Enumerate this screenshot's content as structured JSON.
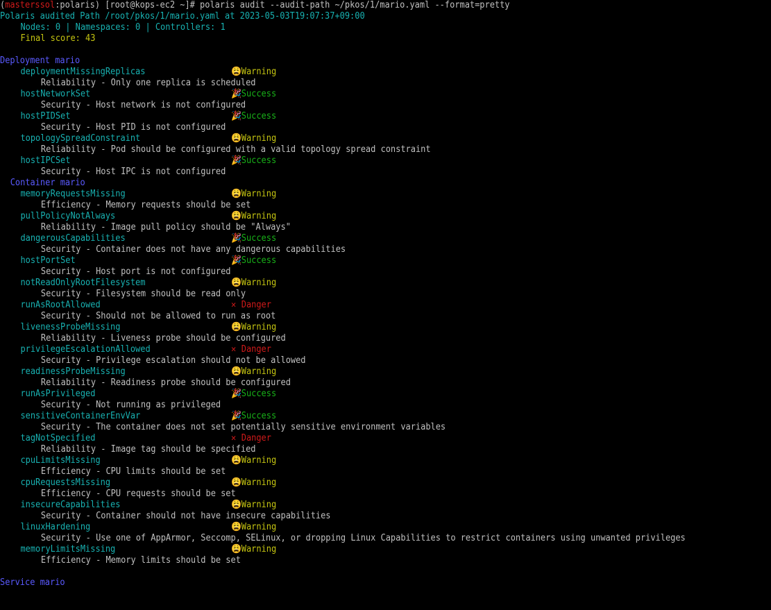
{
  "prompt": {
    "open_paren": "(",
    "cluster": "masterssol",
    "sep": ":",
    "namespace": "polaris",
    "close_paren": ")",
    "user_host": " [root@kops-ec2 ~]# ",
    "command": "polaris audit --audit-path ~/pkos/1/mario.yaml --format=pretty"
  },
  "summary": {
    "audited": "Polaris audited Path /root/pkos/1/mario.yaml at 2023-05-03T19:07:37+09:00",
    "counts": "Nodes: 0 | Namespaces: 0 | Controllers: 1",
    "score": "Final score: 43"
  },
  "status_icons": {
    "Warning": "😩",
    "Success": "🎉",
    "Danger": "✕"
  },
  "deployment": {
    "heading": "Deployment mario",
    "checks": [
      {
        "name": "deploymentMissingReplicas",
        "status": "Warning",
        "detail": "Reliability - Only one replica is scheduled"
      },
      {
        "name": "hostNetworkSet",
        "status": "Success",
        "detail": "Security - Host network is not configured"
      },
      {
        "name": "hostPIDSet",
        "status": "Success",
        "detail": "Security - Host PID is not configured"
      },
      {
        "name": "topologySpreadConstraint",
        "status": "Warning",
        "detail": "Reliability - Pod should be configured with a valid topology spread constraint"
      },
      {
        "name": "hostIPCSet",
        "status": "Success",
        "detail": "Security - Host IPC is not configured"
      }
    ]
  },
  "container": {
    "heading": "Container mario",
    "checks": [
      {
        "name": "memoryRequestsMissing",
        "status": "Warning",
        "detail": "Efficiency - Memory requests should be set"
      },
      {
        "name": "pullPolicyNotAlways",
        "status": "Warning",
        "detail": "Reliability - Image pull policy should be \"Always\""
      },
      {
        "name": "dangerousCapabilities",
        "status": "Success",
        "detail": "Security - Container does not have any dangerous capabilities"
      },
      {
        "name": "hostPortSet",
        "status": "Success",
        "detail": "Security - Host port is not configured"
      },
      {
        "name": "notReadOnlyRootFilesystem",
        "status": "Warning",
        "detail": "Security - Filesystem should be read only"
      },
      {
        "name": "runAsRootAllowed",
        "status": "Danger",
        "detail": "Security - Should not be allowed to run as root"
      },
      {
        "name": "livenessProbeMissing",
        "status": "Warning",
        "detail": "Reliability - Liveness probe should be configured"
      },
      {
        "name": "privilegeEscalationAllowed",
        "status": "Danger",
        "detail": "Security - Privilege escalation should not be allowed"
      },
      {
        "name": "readinessProbeMissing",
        "status": "Warning",
        "detail": "Reliability - Readiness probe should be configured"
      },
      {
        "name": "runAsPrivileged",
        "status": "Success",
        "detail": "Security - Not running as privileged"
      },
      {
        "name": "sensitiveContainerEnvVar",
        "status": "Success",
        "detail": "Security - The container does not set potentially sensitive environment variables"
      },
      {
        "name": "tagNotSpecified",
        "status": "Danger",
        "detail": "Reliability - Image tag should be specified"
      },
      {
        "name": "cpuLimitsMissing",
        "status": "Warning",
        "detail": "Efficiency - CPU limits should be set"
      },
      {
        "name": "cpuRequestsMissing",
        "status": "Warning",
        "detail": "Efficiency - CPU requests should be set"
      },
      {
        "name": "insecureCapabilities",
        "status": "Warning",
        "detail": "Security - Container should not have insecure capabilities"
      },
      {
        "name": "linuxHardening",
        "status": "Warning",
        "detail": "Security - Use one of AppArmor, Seccomp, SELinux, or dropping Linux Capabilities to restrict containers using unwanted privileges"
      },
      {
        "name": "memoryLimitsMissing",
        "status": "Warning",
        "detail": "Efficiency - Memory limits should be set"
      }
    ]
  },
  "service": {
    "heading": "Service mario"
  }
}
